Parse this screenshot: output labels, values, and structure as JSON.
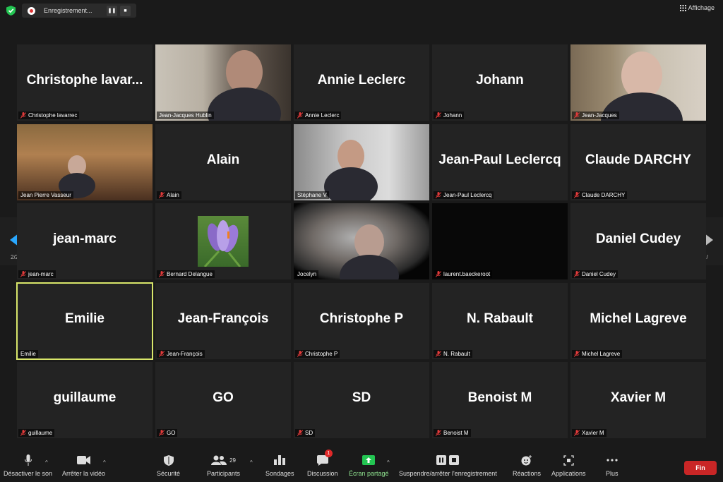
{
  "topbar": {
    "recording_label": "Enregistrement...",
    "view_label": "Affichage"
  },
  "pager": {
    "left_page": "2/2",
    "right_page": "2/"
  },
  "tiles": [
    {
      "display": "Christophe  lavar...",
      "name": "Christophe lavarrec",
      "muted": true,
      "video": false
    },
    {
      "display": "",
      "name": "Jean-Jacques Hublin",
      "muted": false,
      "video": true
    },
    {
      "display": "Annie Leclerc",
      "name": "Annie Leclerc",
      "muted": true,
      "video": false
    },
    {
      "display": "Johann",
      "name": "Johann",
      "muted": true,
      "video": false
    },
    {
      "display": "",
      "name": "Jean-Jacques",
      "muted": true,
      "video": true
    },
    {
      "display": "",
      "name": "Jean Pierre Vasseur",
      "muted": false,
      "video": true
    },
    {
      "display": "Alain",
      "name": "Alain",
      "muted": true,
      "video": false
    },
    {
      "display": "",
      "name": "Stéphane V",
      "muted": false,
      "video": true
    },
    {
      "display": "Jean-Paul Leclercq",
      "name": "Jean-Paul Leclercq",
      "muted": true,
      "video": false
    },
    {
      "display": "Claude DARCHY",
      "name": "Claude DARCHY",
      "muted": true,
      "video": false
    },
    {
      "display": "jean-marc",
      "name": "jean-marc",
      "muted": true,
      "video": false
    },
    {
      "display": "",
      "name": "Bernard Delangue",
      "muted": true,
      "video": false
    },
    {
      "display": "",
      "name": "Jocelyn",
      "muted": false,
      "video": true
    },
    {
      "display": "",
      "name": "laurent.baeckeroot",
      "muted": true,
      "video": true
    },
    {
      "display": "Daniel Cudey",
      "name": "Daniel Cudey",
      "muted": true,
      "video": false
    },
    {
      "display": "Emilie",
      "name": "Emilie",
      "muted": false,
      "video": false
    },
    {
      "display": "Jean-François",
      "name": "Jean-François",
      "muted": true,
      "video": false
    },
    {
      "display": "Christophe P",
      "name": "Christophe P",
      "muted": true,
      "video": false
    },
    {
      "display": "N. Rabault",
      "name": "N. Rabault",
      "muted": true,
      "video": false
    },
    {
      "display": "Michel Lagreve",
      "name": "Michel Lagreve",
      "muted": true,
      "video": false
    },
    {
      "display": "guillaume",
      "name": "guillaume",
      "muted": true,
      "video": false
    },
    {
      "display": "GO",
      "name": "GO",
      "muted": true,
      "video": false
    },
    {
      "display": "SD",
      "name": "SD",
      "muted": true,
      "video": false
    },
    {
      "display": "Benoist M",
      "name": "Benoist M",
      "muted": true,
      "video": false
    },
    {
      "display": "Xavier M",
      "name": "Xavier M",
      "muted": true,
      "video": false
    }
  ],
  "toolbar": {
    "mute": "Désactiver le son",
    "video": "Arrêter la vidéo",
    "security": "Sécurité",
    "participants": "Participants",
    "participants_count": "29",
    "polls": "Sondages",
    "chat": "Discussion",
    "chat_badge": "1",
    "share": "Écran partagé",
    "record": "Suspendre/arrêter l'enregistrement",
    "reactions": "Réactions",
    "apps": "Applications",
    "more": "Plus",
    "end": "Fin"
  },
  "colors": {
    "active_speaker": "#d8e66a",
    "end_button": "#c92626",
    "share_green": "#23c552",
    "muted_red": "#e03a3a"
  }
}
